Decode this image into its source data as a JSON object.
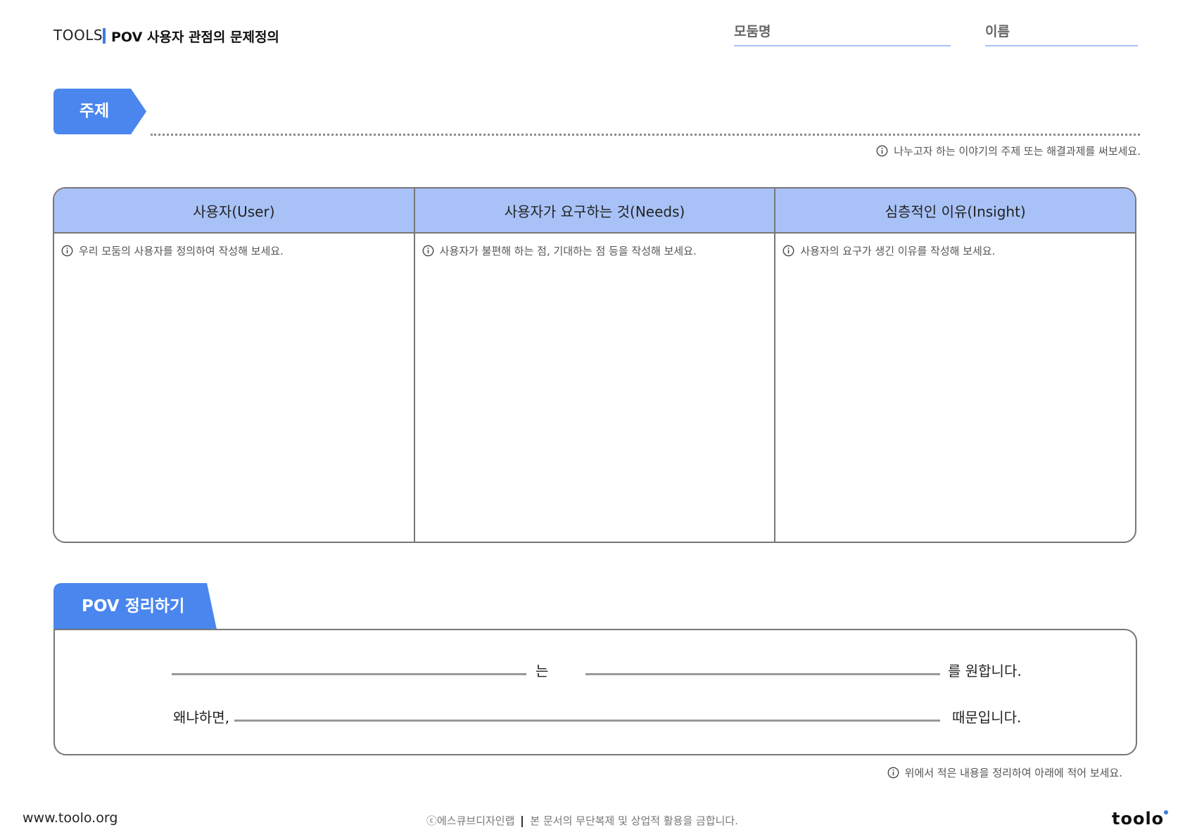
{
  "header": {
    "tools_label": "TOOLS",
    "title": "POV 사용자 관점의 문제정의",
    "module_label": "모둠명",
    "name_label": "이름"
  },
  "topic": {
    "tag": "주제",
    "hint": "나누고자 하는 이야기의 주제 또는 해결과제를 써보세요."
  },
  "columns": [
    {
      "header": "사용자(User)",
      "hint": "우리 모둠의 사용자를 정의하여  작성해 보세요."
    },
    {
      "header": "사용자가 요구하는 것(Needs)",
      "hint": "사용자가 불편해 하는 점, 기대하는 점 등을 작성해 보세요."
    },
    {
      "header": "심층적인 이유(Insight)",
      "hint": "사용자의 요구가 생긴 이유를 작성해 보세요."
    }
  ],
  "pov": {
    "tab": "POV 정리하기",
    "word_neun": "는",
    "word_want": "를 원합니다.",
    "word_because": "왜냐하면,",
    "word_reason": "때문입니다.",
    "hint": "위에서 적은 내용을 정리하여 아래에 적어 보세요."
  },
  "footer": {
    "url": "www.toolo.org",
    "copyright": "ⓒ에스큐브디자인랩",
    "notice": "본 문서의 무단복제 및 상업적 활용을 금합니다.",
    "logo": "toolo"
  },
  "colors": {
    "accent": "#4a86ee",
    "header_fill": "#a8c2f7",
    "field_line": "#a8bff7"
  }
}
